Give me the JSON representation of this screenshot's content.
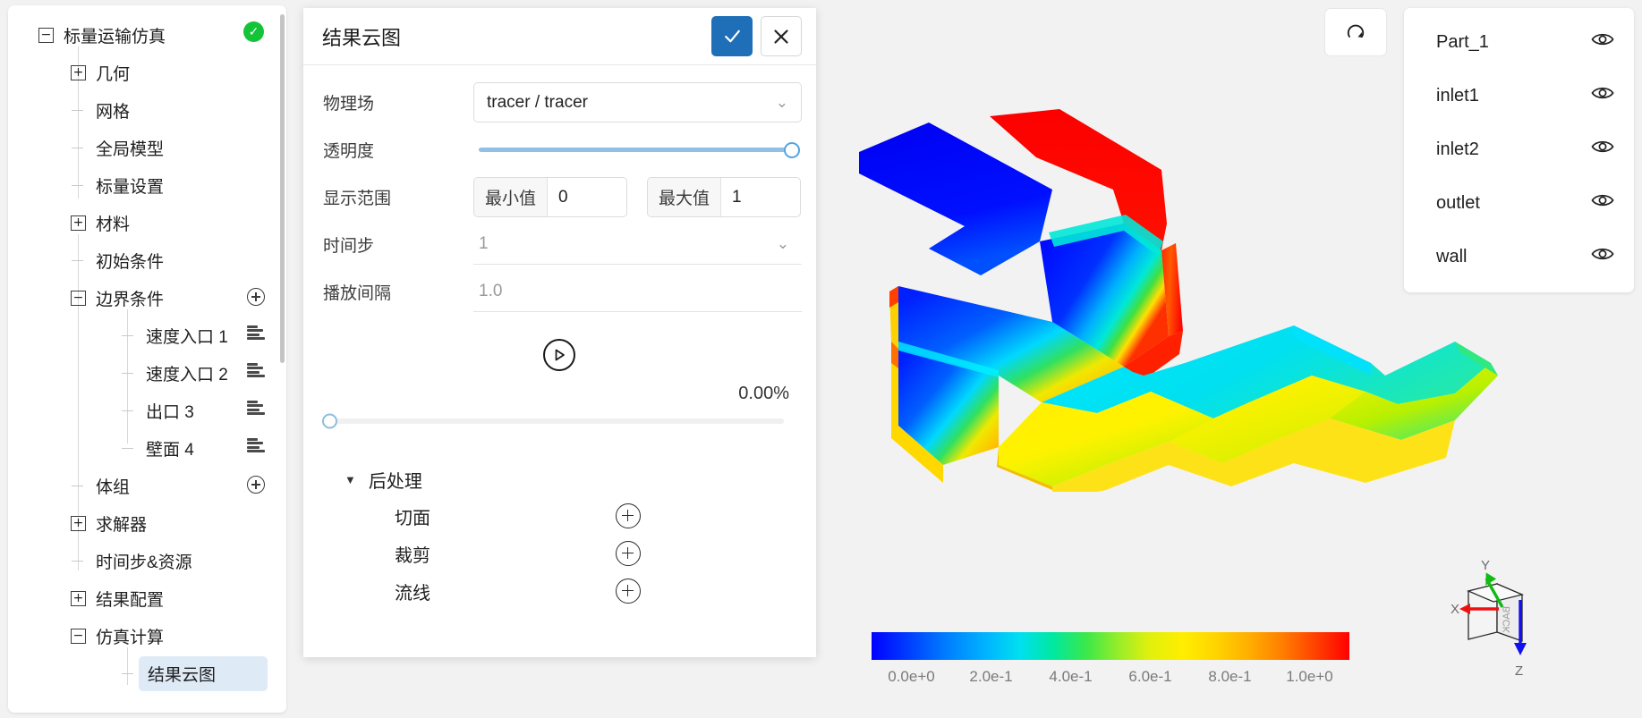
{
  "sidebar": {
    "root": {
      "label": "标量运输仿真",
      "status": "completed"
    },
    "items": [
      {
        "label": "几何",
        "twisty": "+",
        "depth": 1,
        "right": null
      },
      {
        "label": "网格",
        "twisty": null,
        "depth": 1,
        "right": null
      },
      {
        "label": "全局模型",
        "twisty": null,
        "depth": 1,
        "right": null
      },
      {
        "label": "标量设置",
        "twisty": null,
        "depth": 1,
        "right": null
      },
      {
        "label": "材料",
        "twisty": "+",
        "depth": 1,
        "right": null
      },
      {
        "label": "初始条件",
        "twisty": null,
        "depth": 1,
        "right": null
      },
      {
        "label": "边界条件",
        "twisty": "-",
        "depth": 1,
        "right": "plus-icon"
      },
      {
        "label": "速度入口 1",
        "twisty": null,
        "depth": 2,
        "right": "menu-icon"
      },
      {
        "label": "速度入口 2",
        "twisty": null,
        "depth": 2,
        "right": "menu-icon"
      },
      {
        "label": "出口 3",
        "twisty": null,
        "depth": 2,
        "right": "menu-icon"
      },
      {
        "label": "壁面 4",
        "twisty": null,
        "depth": 2,
        "right": "menu-icon"
      },
      {
        "label": "体组",
        "twisty": null,
        "depth": 1,
        "right": "plus-icon"
      },
      {
        "label": "求解器",
        "twisty": "+",
        "depth": 1,
        "right": null
      },
      {
        "label": "时间步&资源",
        "twisty": null,
        "depth": 1,
        "right": null
      },
      {
        "label": "结果配置",
        "twisty": "+",
        "depth": 1,
        "right": null
      },
      {
        "label": "仿真计算",
        "twisty": "-",
        "depth": 1,
        "right": null
      },
      {
        "label": "结果云图",
        "twisty": null,
        "depth": 2,
        "right": null,
        "selected": true
      }
    ]
  },
  "dialog": {
    "title": "结果云图",
    "confirm_icon": "check-icon",
    "cancel_icon": "close-icon",
    "fields": {
      "field_label": "物理场",
      "field_value": "tracer / tracer",
      "opacity_label": "透明度",
      "opacity_value": 100,
      "range_label": "显示范围",
      "min_tag": "最小值",
      "min_value": "0",
      "max_tag": "最大值",
      "max_value": "1",
      "timestep_label": "时间步",
      "timestep_value": "1",
      "interval_label": "播放间隔",
      "interval_value": "1.0"
    },
    "play_icon": "play-circle-icon",
    "percent": "0.00%",
    "progress_value": 0,
    "post": {
      "title": "后处理",
      "expanded": true,
      "items": [
        {
          "label": "切面",
          "add_icon": "plus-circle-icon"
        },
        {
          "label": "裁剪",
          "add_icon": "plus-circle-icon"
        },
        {
          "label": "流线",
          "add_icon": "plus-circle-icon"
        }
      ]
    }
  },
  "parts": {
    "items": [
      {
        "label": "Part_1",
        "visibility_icon": "eye-icon"
      },
      {
        "label": "inlet1",
        "visibility_icon": "eye-icon"
      },
      {
        "label": "inlet2",
        "visibility_icon": "eye-icon"
      },
      {
        "label": "outlet",
        "visibility_icon": "eye-icon"
      },
      {
        "label": "wall",
        "visibility_icon": "eye-icon"
      }
    ]
  },
  "toolbar": {
    "reset_view_icon": "reset-view-icon"
  },
  "colorbar": {
    "ticks": [
      "0.0e+0",
      "2.0e-1",
      "4.0e-1",
      "6.0e-1",
      "8.0e-1",
      "1.0e+0"
    ],
    "min": 0,
    "max": 1,
    "colormap": "jet"
  },
  "axis_widget": {
    "x_label": "X",
    "y_label": "Y",
    "z_label": "Z",
    "face_label": "BACK",
    "x_color": "#ee1111",
    "y_color": "#11bb11",
    "z_color": "#1111ee"
  }
}
